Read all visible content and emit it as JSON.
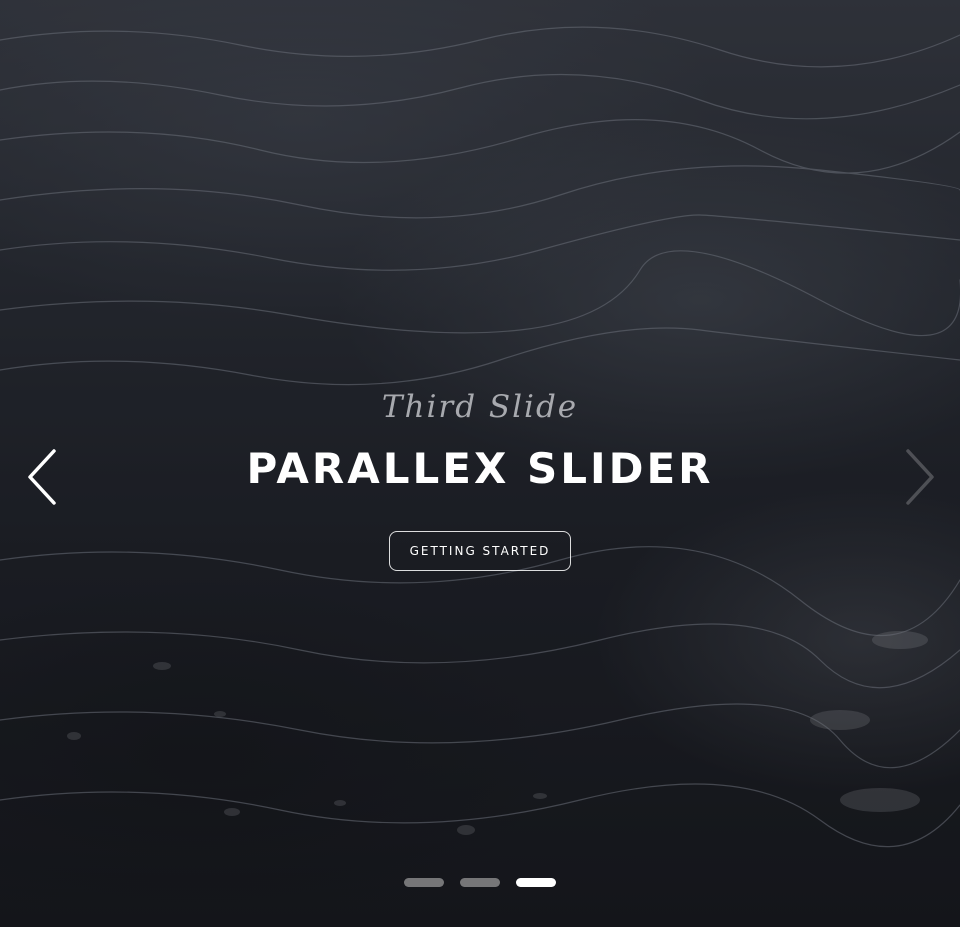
{
  "slider": {
    "subtitle": "Third Slide",
    "title": "PARALLEX SLIDER",
    "cta_label": "GETTING STARTED",
    "prev_icon": "chevron-left-icon",
    "next_icon": "chevron-right-icon",
    "active_slide": 3,
    "slide_count": 3,
    "colors": {
      "text": "#ffffff",
      "subtitle": "#c9ccd1",
      "dot_inactive": "#9a9a9a",
      "dot_active": "#ffffff"
    }
  }
}
